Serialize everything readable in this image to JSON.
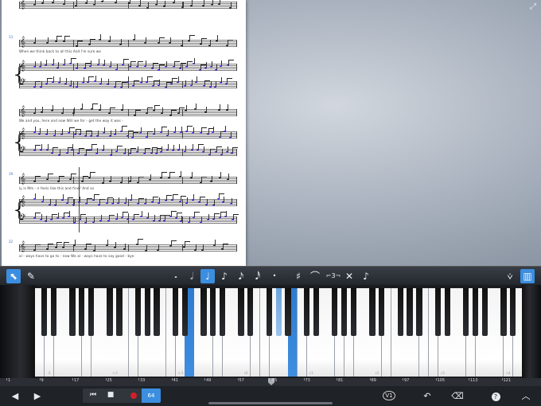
{
  "score": {
    "systems": [
      {
        "measure": "",
        "lyric": ""
      },
      {
        "measure": "13",
        "lyric": "When   we   think   back   to   all   this   And   I'm   sure   we"
      },
      {
        "measure": "",
        "lyric": ""
      },
      {
        "measure": "",
        "lyric": "We  and  you,   here  and  now   Will  we  for - get  the  way   it  was -"
      },
      {
        "measure": "",
        "lyric": ""
      },
      {
        "measure": "19",
        "lyric": "ly   is   Mm - n   feels   like   this   and   fine?   And   so"
      },
      {
        "measure": "",
        "lyric": ""
      },
      {
        "measure": "22",
        "lyric": "al - ways   have   to   go   to - now   We   al - ways   have   to   say   good - bye"
      }
    ]
  },
  "toolbar": {
    "tools": [
      {
        "name": "select-tool",
        "icon": "arrow-pointer-icon",
        "glyph": "⬉",
        "active": true
      },
      {
        "name": "pen-tool",
        "icon": "pen-icon",
        "glyph": "✎",
        "active": false
      }
    ],
    "durations": [
      {
        "name": "whole-note",
        "glyph": "𝅝"
      },
      {
        "name": "half-note",
        "glyph": "𝅗𝅥"
      },
      {
        "name": "quarter-note",
        "glyph": "♩",
        "active": true
      },
      {
        "name": "eighth-note",
        "glyph": "♪"
      },
      {
        "name": "sixteenth-note",
        "glyph": "𝅘𝅥𝅯"
      },
      {
        "name": "thirtysecond-note",
        "glyph": "𝅘𝅥𝅰"
      },
      {
        "name": "dot",
        "glyph": "•"
      }
    ],
    "modifiers": [
      {
        "name": "sharp",
        "glyph": "♯"
      },
      {
        "name": "tie",
        "glyph": "⌒"
      },
      {
        "name": "triplet",
        "glyph": "⌐3¬"
      },
      {
        "name": "delete",
        "glyph": "✕"
      },
      {
        "name": "grace-note",
        "glyph": "♪"
      }
    ],
    "right": [
      {
        "name": "voice-toggle",
        "glyph": "⩒"
      },
      {
        "name": "keyboard-toggle",
        "glyph": "▥",
        "active": true
      }
    ]
  },
  "keyboard": {
    "highlight_color": "#3b8ee0",
    "octave_labels": [
      "-3",
      "c-2",
      "c-1",
      "c0",
      "c1",
      "c2",
      "c3",
      "c4"
    ]
  },
  "ruler": {
    "ticks": [
      "1",
      "9",
      "17",
      "25",
      "33",
      "41",
      "49",
      "57",
      "65",
      "73",
      "81",
      "89",
      "97",
      "105",
      "113",
      "121"
    ]
  },
  "bottom": {
    "prev": "◀",
    "play": "▶",
    "rewind": "⏮",
    "stop": "■",
    "tempo": "64",
    "voice": "V1",
    "undo": "↶",
    "clear": "⌫",
    "help": "?",
    "collapse": "︿"
  }
}
